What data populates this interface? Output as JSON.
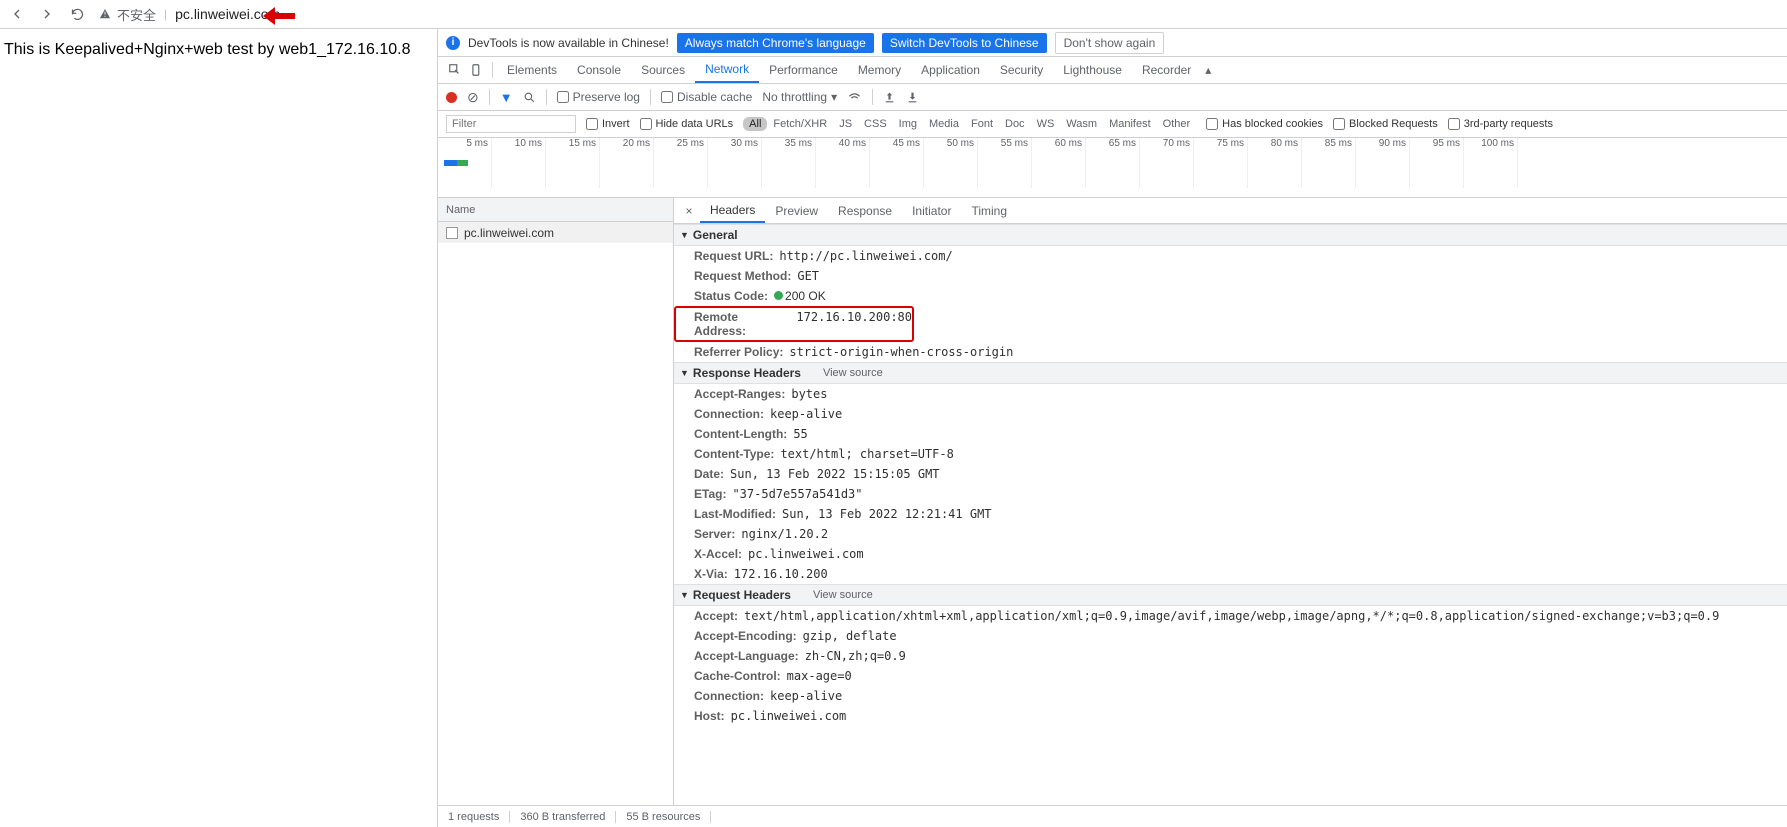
{
  "browser": {
    "insecure_label": "不安全",
    "url": "pc.linweiwei.com"
  },
  "page": {
    "body_text": "This is Keepalived+Nginx+web test by web1_172.16.10.8"
  },
  "infobar": {
    "text": "DevTools is now available in Chinese!",
    "btn1": "Always match Chrome's language",
    "btn2": "Switch DevTools to Chinese",
    "btn3": "Don't show again"
  },
  "tabs": [
    "Elements",
    "Console",
    "Sources",
    "Network",
    "Performance",
    "Memory",
    "Application",
    "Security",
    "Lighthouse",
    "Recorder"
  ],
  "active_tab": "Network",
  "toolbar": {
    "preserve_log": "Preserve log",
    "disable_cache": "Disable cache",
    "throttling": "No throttling"
  },
  "filterbar": {
    "filter_placeholder": "Filter",
    "invert": "Invert",
    "hide_data_urls": "Hide data URLs",
    "types": [
      "All",
      "Fetch/XHR",
      "JS",
      "CSS",
      "Img",
      "Media",
      "Font",
      "Doc",
      "WS",
      "Wasm",
      "Manifest",
      "Other"
    ],
    "active_type": "All",
    "blocked_cookies": "Has blocked cookies",
    "blocked_requests": "Blocked Requests",
    "third_party": "3rd-party requests"
  },
  "timeline_ticks": [
    "5 ms",
    "10 ms",
    "15 ms",
    "20 ms",
    "25 ms",
    "30 ms",
    "35 ms",
    "40 ms",
    "45 ms",
    "50 ms",
    "55 ms",
    "60 ms",
    "65 ms",
    "70 ms",
    "75 ms",
    "80 ms",
    "85 ms",
    "90 ms",
    "95 ms",
    "100 ms"
  ],
  "request_list": {
    "header": "Name",
    "rows": [
      "pc.linweiwei.com"
    ]
  },
  "detail_tabs": [
    "Headers",
    "Preview",
    "Response",
    "Initiator",
    "Timing"
  ],
  "active_detail_tab": "Headers",
  "general": {
    "title": "General",
    "request_url": {
      "k": "Request URL:",
      "v": "http://pc.linweiwei.com/"
    },
    "request_method": {
      "k": "Request Method:",
      "v": "GET"
    },
    "status_code": {
      "k": "Status Code:",
      "v": "200 OK"
    },
    "remote_address": {
      "k": "Remote Address:",
      "v": "172.16.10.200:80"
    },
    "referrer_policy": {
      "k": "Referrer Policy:",
      "v": "strict-origin-when-cross-origin"
    }
  },
  "response_headers": {
    "title": "Response Headers",
    "view_source": "View source",
    "items": [
      {
        "k": "Accept-Ranges:",
        "v": "bytes"
      },
      {
        "k": "Connection:",
        "v": "keep-alive"
      },
      {
        "k": "Content-Length:",
        "v": "55"
      },
      {
        "k": "Content-Type:",
        "v": "text/html; charset=UTF-8"
      },
      {
        "k": "Date:",
        "v": "Sun, 13 Feb 2022 15:15:05 GMT"
      },
      {
        "k": "ETag:",
        "v": "\"37-5d7e557a541d3\""
      },
      {
        "k": "Last-Modified:",
        "v": "Sun, 13 Feb 2022 12:21:41 GMT"
      },
      {
        "k": "Server:",
        "v": "nginx/1.20.2"
      },
      {
        "k": "X-Accel:",
        "v": "pc.linweiwei.com"
      },
      {
        "k": "X-Via:",
        "v": "172.16.10.200"
      }
    ]
  },
  "request_headers": {
    "title": "Request Headers",
    "view_source": "View source",
    "items": [
      {
        "k": "Accept:",
        "v": "text/html,application/xhtml+xml,application/xml;q=0.9,image/avif,image/webp,image/apng,*/*;q=0.8,application/signed-exchange;v=b3;q=0.9"
      },
      {
        "k": "Accept-Encoding:",
        "v": "gzip, deflate"
      },
      {
        "k": "Accept-Language:",
        "v": "zh-CN,zh;q=0.9"
      },
      {
        "k": "Cache-Control:",
        "v": "max-age=0"
      },
      {
        "k": "Connection:",
        "v": "keep-alive"
      },
      {
        "k": "Host:",
        "v": "pc.linweiwei.com"
      }
    ]
  },
  "statusbar": {
    "requests": "1 requests",
    "transferred": "360 B transferred",
    "resources": "55 B resources"
  }
}
